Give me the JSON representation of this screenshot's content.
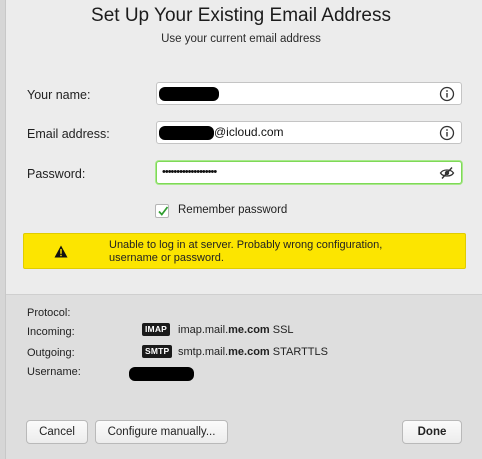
{
  "dialog": {
    "title": "Set Up Your Existing Email Address",
    "subtitle": "Use your current email address"
  },
  "form": {
    "name_label": "Your name:",
    "email_label": "Email address:",
    "email_suffix": "@icloud.com",
    "password_label": "Password:",
    "password_value": "•••••••••••••••••••",
    "remember_label": "Remember password",
    "remember_checked": true
  },
  "warning": {
    "line1": "Unable to log in at server. Probably wrong configuration,",
    "line2": "username or password."
  },
  "server_info": {
    "protocol_label": "Protocol:",
    "incoming_label": "Incoming:",
    "incoming_badge": "IMAP",
    "incoming_host_prefix": "imap.mail.",
    "incoming_host_bold": "me.com",
    "incoming_security": " SSL",
    "outgoing_label": "Outgoing:",
    "outgoing_badge": "SMTP",
    "outgoing_host_prefix": "smtp.mail.",
    "outgoing_host_bold": "me.com",
    "outgoing_security": " STARTTLS",
    "username_label": "Username:"
  },
  "buttons": {
    "cancel": "Cancel",
    "configure_manually": "Configure manually...",
    "done": "Done"
  },
  "icons": {
    "info": "info-circle-icon",
    "hide_password": "eye-slash-icon",
    "warning": "warning-triangle-icon",
    "check": "checkmark-icon"
  },
  "colors": {
    "warning_bg": "#fce500",
    "focus_ring": "#7ed957",
    "badge_bg": "#1a1a1a"
  }
}
